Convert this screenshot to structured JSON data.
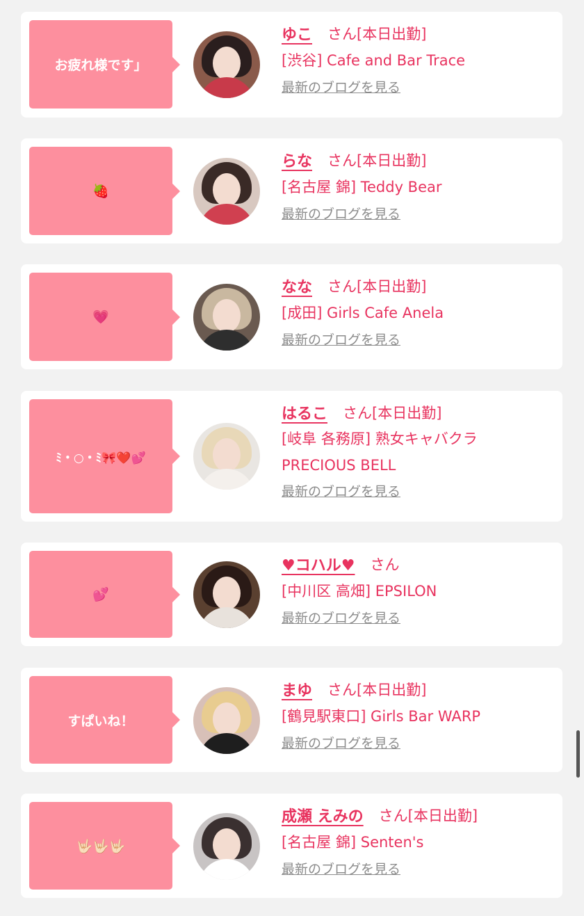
{
  "cards": [
    {
      "bubble": "お疲れ様です」",
      "name": "ゆこ",
      "suffix": "さん[本日出勤]",
      "shop": "[渋谷] Cafe and Bar Trace",
      "blog": "最新のブログを見る"
    },
    {
      "bubble": "🍓",
      "name": "らな",
      "suffix": "さん[本日出勤]",
      "shop": "[名古屋 錦] Teddy Bear",
      "blog": "最新のブログを見る"
    },
    {
      "bubble": "💗",
      "name": "なな",
      "suffix": "さん[本日出勤]",
      "shop": "[成田] Girls Cafe Anela",
      "blog": "最新のブログを見る"
    },
    {
      "bubble": "ﾐ・○・ﾐ🎀❤️💕",
      "name": "はるこ",
      "suffix": "さん[本日出勤]",
      "shop": "[岐阜 各務原]  熟女キャバクラPRECIOUS BELL",
      "blog": "最新のブログを見る"
    },
    {
      "bubble": "💕",
      "name": "♥コハル♥",
      "suffix": "さん",
      "shop": "[中川区 高畑] EPSILON",
      "blog": "最新のブログを見る"
    },
    {
      "bubble": "すぱいね！",
      "name": "まゆ",
      "suffix": "さん[本日出勤]",
      "shop": "[鶴見駅東口] Girls Bar WARP",
      "blog": "最新のブログを見る"
    },
    {
      "bubble": "🤟🏻🤟🏻🤟🏻",
      "name": "成瀬 えみの",
      "suffix": "さん[本日出勤]",
      "shop": "[名古屋 錦] Senten's",
      "blog": "最新のブログを見る"
    }
  ],
  "colors": {
    "accent": "#e8335f",
    "bubble": "#fd8f9e",
    "muted": "#8c8c8c",
    "background": "#f2f2f2"
  }
}
